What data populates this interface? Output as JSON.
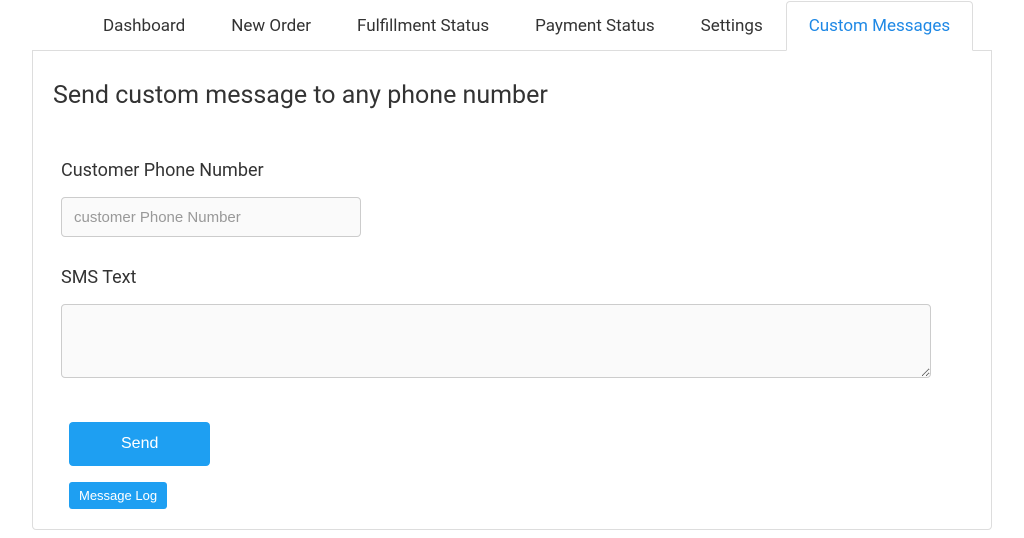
{
  "tabs": [
    {
      "label": "Dashboard",
      "active": false
    },
    {
      "label": "New Order",
      "active": false
    },
    {
      "label": "Fulfillment Status",
      "active": false
    },
    {
      "label": "Payment Status",
      "active": false
    },
    {
      "label": "Settings",
      "active": false
    },
    {
      "label": "Custom Messages",
      "active": true
    }
  ],
  "panel": {
    "title": "Send custom message to any phone number",
    "phone_label": "Customer Phone Number",
    "phone_placeholder": "customer Phone Number",
    "phone_value": "",
    "sms_label": "SMS Text",
    "sms_value": "",
    "send_button": "Send",
    "log_button": "Message Log"
  }
}
